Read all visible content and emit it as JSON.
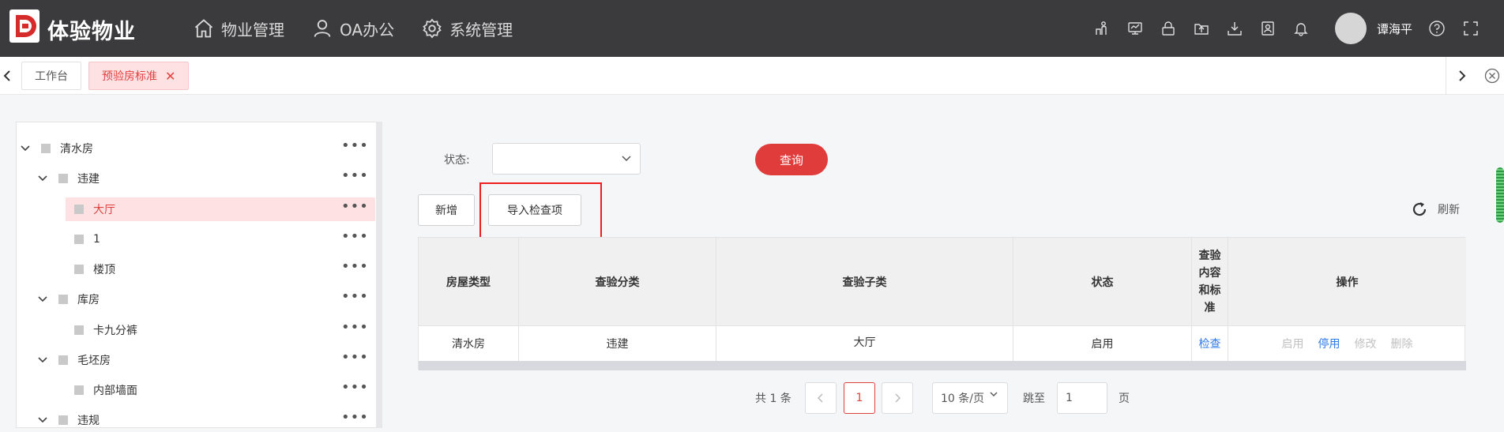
{
  "app": {
    "title": "体验物业"
  },
  "nav": [
    {
      "label": "物业管理",
      "icon": "home-icon"
    },
    {
      "label": "OA办公",
      "icon": "user-icon"
    },
    {
      "label": "系统管理",
      "icon": "gear-icon"
    }
  ],
  "header": {
    "username": "谭海平"
  },
  "tabs": [
    {
      "label": "工作台",
      "active": false
    },
    {
      "label": "预验房标准",
      "active": true,
      "close": "✕"
    }
  ],
  "tree": [
    {
      "label": "清水房",
      "level": 0,
      "expanded": true
    },
    {
      "label": "违建",
      "level": 1,
      "expanded": true
    },
    {
      "label": "大厅",
      "level": 2,
      "selected": true
    },
    {
      "label": "1",
      "level": 2
    },
    {
      "label": "楼顶",
      "level": 2
    },
    {
      "label": "库房",
      "level": 1,
      "expanded": true
    },
    {
      "label": "卡九分裤",
      "level": 2
    },
    {
      "label": "毛坯房",
      "level": 1,
      "expanded": true
    },
    {
      "label": "内部墙面",
      "level": 2
    },
    {
      "label": "违规",
      "level": 1,
      "expanded": true
    }
  ],
  "tree_more": "•••",
  "filter": {
    "status_label": "状态:",
    "status_value": "",
    "query_button": "查询"
  },
  "toolbar": {
    "add_button": "新增",
    "import_button": "导入检查项",
    "refresh": "刷新"
  },
  "table": {
    "headers": [
      "房屋类型",
      "查验分类",
      "查验子类",
      "状态",
      "查验内容和标准",
      "操作"
    ],
    "rows": [
      {
        "house_type": "清水房",
        "category": "违建",
        "subcategory": "大厅",
        "status": "启用",
        "content_link": "检查",
        "ops": [
          "启用",
          "停用",
          "修改",
          "删除"
        ]
      }
    ]
  },
  "pager": {
    "total": "共 1 条",
    "current": "1",
    "page_size": "10 条/页",
    "jump_label": "跳至",
    "jump_value": "1",
    "page_unit": "页"
  },
  "colors": {
    "accent": "#e13c3c",
    "header_bg": "#3b3b3d",
    "link": "#2f7ae5"
  }
}
